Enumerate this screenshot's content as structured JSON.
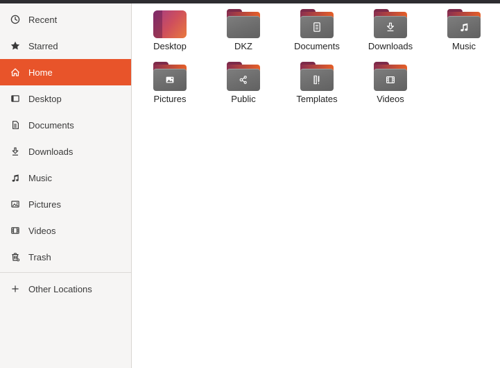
{
  "colors": {
    "accent": "#E8542A",
    "top_strip": "#2e2d31",
    "folder_body": "#6e6e6e",
    "folder_flap_from": "#8a2f50",
    "folder_flap_to": "#e55f28",
    "folder_tab": "#7d2a49"
  },
  "sidebar": {
    "items": [
      {
        "label": "Recent",
        "icon": "clock-icon",
        "selected": false
      },
      {
        "label": "Starred",
        "icon": "star-icon",
        "selected": false
      },
      {
        "label": "Home",
        "icon": "home-icon",
        "selected": true
      },
      {
        "label": "Desktop",
        "icon": "desktop-icon",
        "selected": false
      },
      {
        "label": "Documents",
        "icon": "documents-icon",
        "selected": false
      },
      {
        "label": "Downloads",
        "icon": "downloads-icon",
        "selected": false
      },
      {
        "label": "Music",
        "icon": "music-icon",
        "selected": false
      },
      {
        "label": "Pictures",
        "icon": "pictures-icon",
        "selected": false
      },
      {
        "label": "Videos",
        "icon": "videos-icon",
        "selected": false
      },
      {
        "label": "Trash",
        "icon": "trash-icon",
        "selected": false
      }
    ],
    "footer_item": {
      "label": "Other Locations",
      "icon": "plus-icon"
    }
  },
  "files": {
    "items": [
      {
        "name": "Desktop",
        "icon": "desktop-gradient-tile",
        "emblem": null
      },
      {
        "name": "DKZ",
        "icon": "folder",
        "emblem": null
      },
      {
        "name": "Documents",
        "icon": "folder",
        "emblem": "document-emblem"
      },
      {
        "name": "Downloads",
        "icon": "folder",
        "emblem": "download-emblem"
      },
      {
        "name": "Music",
        "icon": "folder",
        "emblem": "music-emblem"
      },
      {
        "name": "Pictures",
        "icon": "folder",
        "emblem": "picture-emblem"
      },
      {
        "name": "Public",
        "icon": "folder",
        "emblem": "share-emblem"
      },
      {
        "name": "Templates",
        "icon": "folder",
        "emblem": "templates-emblem"
      },
      {
        "name": "Videos",
        "icon": "folder",
        "emblem": "video-emblem"
      }
    ]
  }
}
